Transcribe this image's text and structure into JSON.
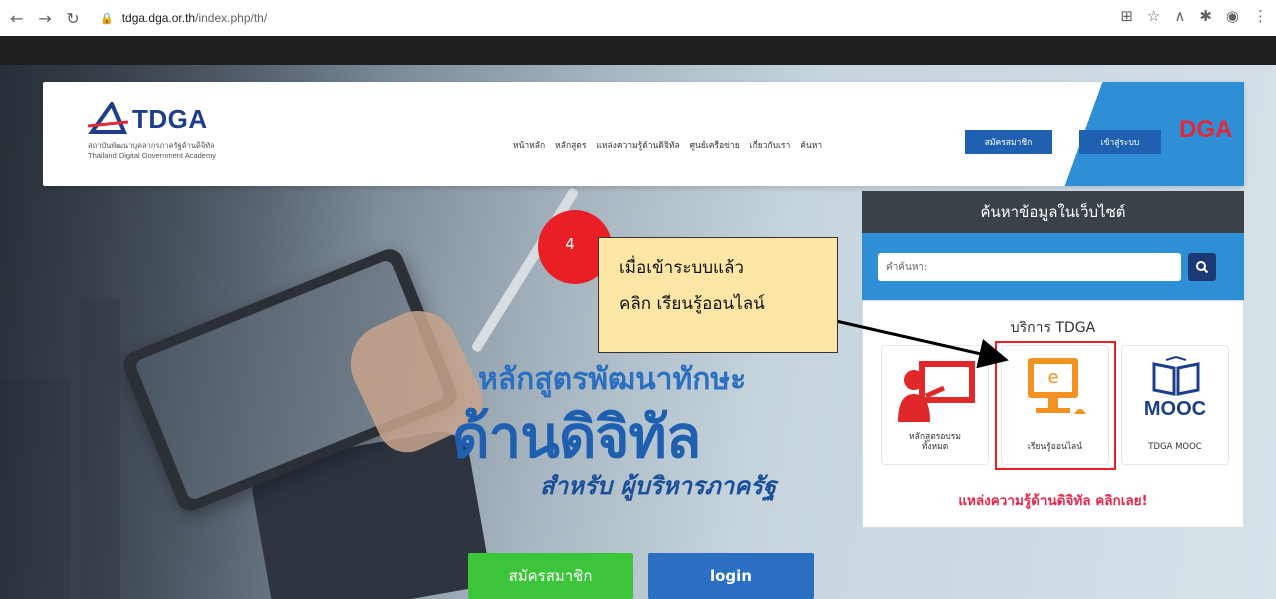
{
  "browser": {
    "url_domain": "tdga.dga.or.th",
    "url_path": "/index.php/th/"
  },
  "header": {
    "logo_text": "TDGA",
    "logo_sub_th": "สถาบันพัฒนาบุคลากรภาครัฐด้านดิจิทัล",
    "logo_sub_en": "Thailand Digital Government Academy",
    "menu": [
      {
        "label": "หน้าหลัก"
      },
      {
        "label": "หลักสูตร"
      },
      {
        "label": "แหล่งความรู้ด้านดิจิทัล"
      },
      {
        "label": "ศูนย์เครือข่าย"
      },
      {
        "label": "เกี่ยวกับเรา"
      },
      {
        "label": "ค้นหา"
      }
    ],
    "register_label": "สมัครสมาชิก",
    "login_label": "เข้าสู่ระบบ",
    "dga_logo": "DGA"
  },
  "hero": {
    "title_line1": "หลักสูตรพัฒนาทักษะ",
    "title_line2": "ด้านดิจิทัล",
    "title_line3": "สำหรับ ผู้บริหารภาครัฐ",
    "register_button": "สมัครสมาชิก",
    "login_button": "login"
  },
  "search": {
    "heading": "ค้นหาข้อมูลในเว็บไซต์",
    "placeholder": "คำค้นหา:"
  },
  "services": {
    "title": "บริการ TDGA",
    "items": [
      {
        "caption_line1": "หลักสูตรอบรม",
        "caption_line2": "ทั้งหมด"
      },
      {
        "caption_line1": "เรียนรู้ออนไลน์",
        "icon_letter": "e"
      },
      {
        "caption_line1": "TDGA MOOC",
        "icon_text": "MOOC"
      }
    ],
    "link_text": "แหล่งความรู้ด้านดิจิทัล คลิกเลย!"
  },
  "annotation": {
    "step_number": "4",
    "line1": "เมื่อเข้าระบบแล้ว",
    "line2": "คลิก เรียนรู้ออนไลน์"
  },
  "colors": {
    "brand_blue": "#1f61b0",
    "accent_red": "#ea1f25",
    "register_green": "#3cc43a",
    "callout_yellow": "#fce6a5"
  }
}
